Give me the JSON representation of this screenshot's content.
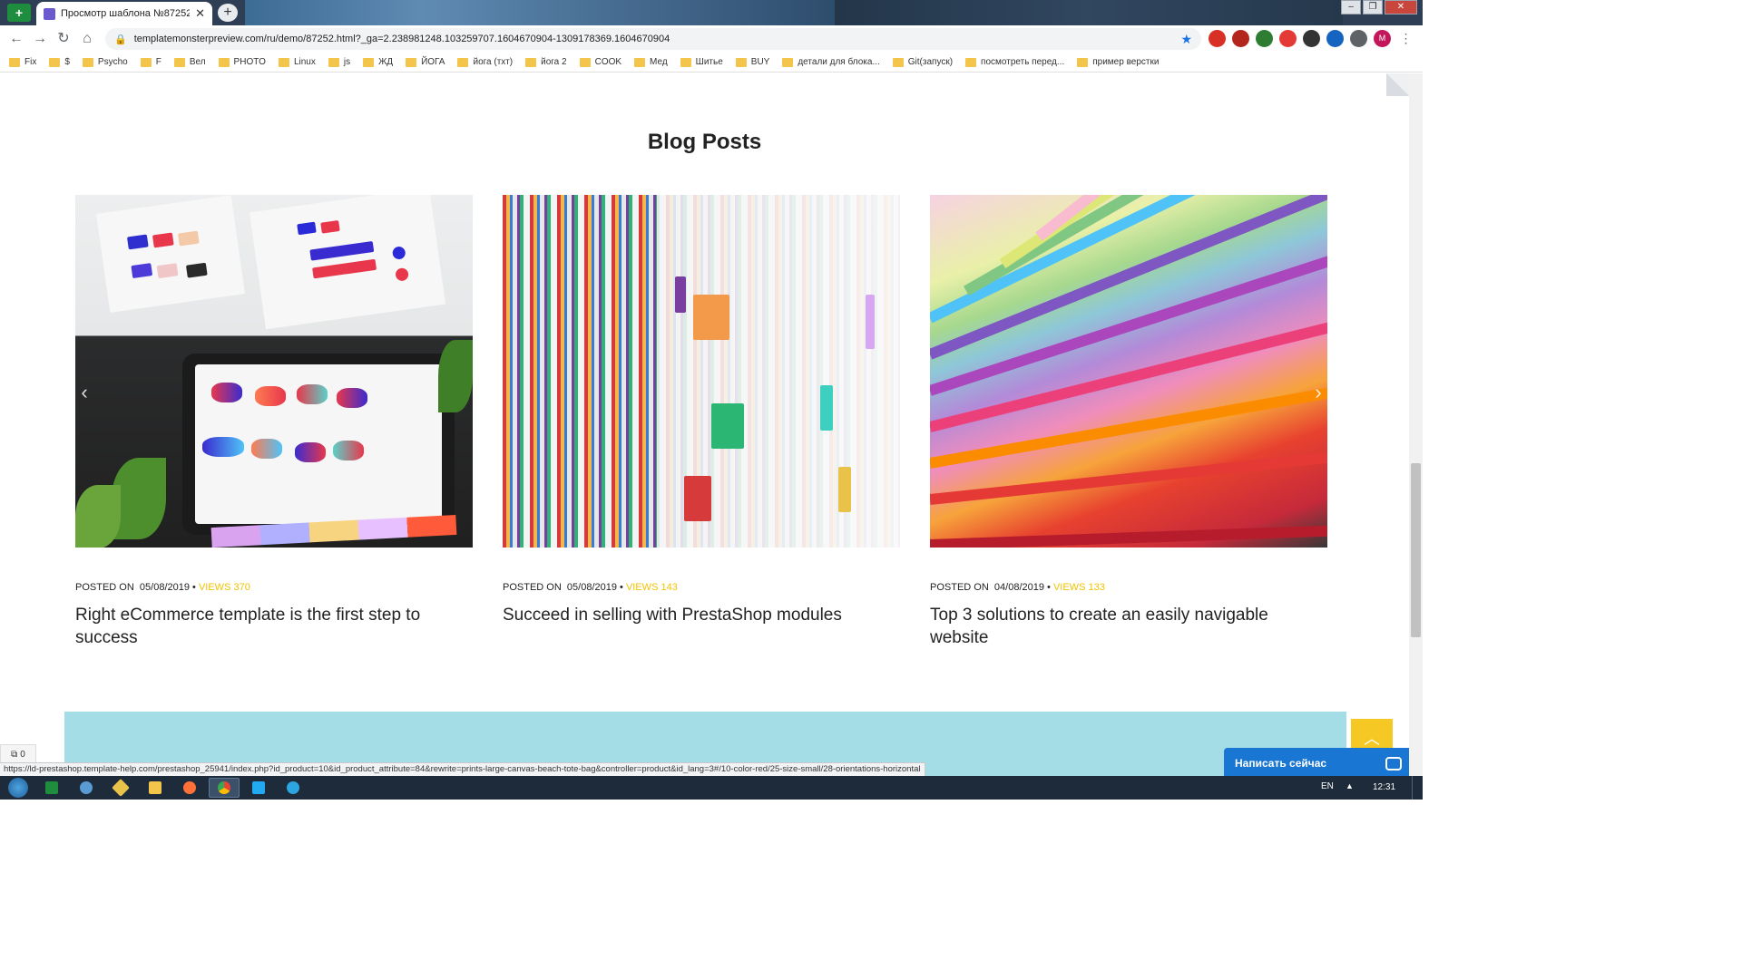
{
  "browser": {
    "tab_title": "Просмотр шаблона №87252",
    "tab_close": "✕",
    "new_tab": "+",
    "url": "templatemonsterpreview.com/ru/demo/87252.html?_ga=2.238981248.103259707.1604670904-1309178369.1604670904",
    "profile_initial": "M",
    "window_controls": [
      "–",
      "❐",
      "✕"
    ],
    "bookmarks": [
      "Fix",
      "$",
      "Psycho",
      "F",
      "Вел",
      "PHOTO",
      "Linux",
      "js",
      "ЖД",
      "ЙОГА",
      "йога (тхт)",
      "йога 2",
      "COOK",
      "Мед",
      "Шитье",
      "BUY",
      "детали для блока...",
      "Git(запуск)",
      "посмотреть перед...",
      "пример верстки"
    ]
  },
  "blog": {
    "section_title": "Blog Posts",
    "posts": [
      {
        "posted_label": "POSTED ON",
        "date": "05/08/2019",
        "views_label": "VIEWS 370",
        "title": "Right eCommerce template is the first step to success"
      },
      {
        "posted_label": "POSTED ON",
        "date": "05/08/2019",
        "views_label": "VIEWS 143",
        "title": "Succeed in selling with PrestaShop modules"
      },
      {
        "posted_label": "POSTED ON",
        "date": "04/08/2019",
        "views_label": "VIEWS 133",
        "title": "Top 3 solutions to create an easily navigable website"
      }
    ],
    "arrow_prev": "‹",
    "arrow_next": "›"
  },
  "widgets": {
    "chat_label": "Написать сейчас",
    "to_top": "︿",
    "compare_count": "0"
  },
  "status_bar": {
    "url": "https://ld-prestashop.template-help.com/prestashop_25941/index.php?id_product=10&id_product_attribute=84&rewrite=prints-large-canvas-beach-tote-bag&controller=product&id_lang=3#/10-color-red/25-size-small/28-orientations-horizontal"
  },
  "taskbar": {
    "lang": "EN",
    "tray_arrow": "▲",
    "clock": "12:31"
  },
  "colors": {
    "accent_views": "#f2c200",
    "newsletter_bg": "#a5dde7",
    "to_top_bg": "#f5c824",
    "chat_bg": "#1976d2"
  }
}
